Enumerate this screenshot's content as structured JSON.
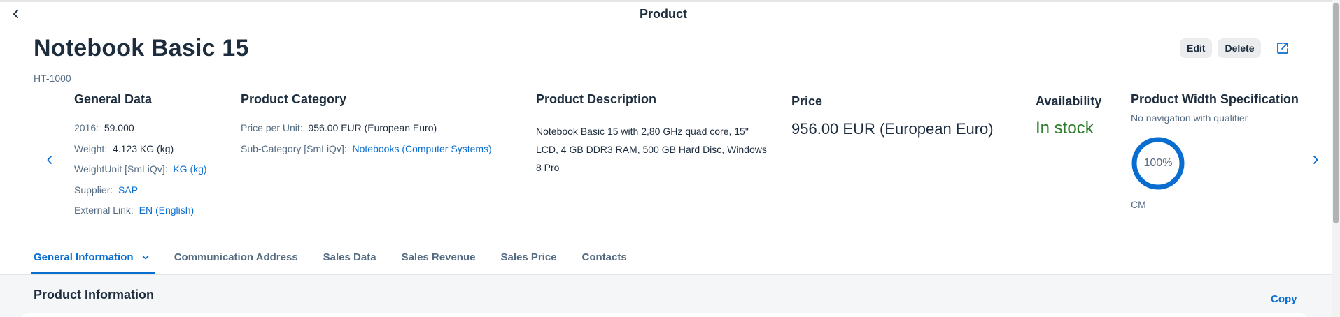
{
  "header": {
    "title": "Product"
  },
  "object": {
    "title": "Notebook Basic 15",
    "subtitle": "HT-1000"
  },
  "actions": {
    "edit": "Edit",
    "delete": "Delete"
  },
  "general_data": {
    "title": "General Data",
    "fields": [
      {
        "label": "2016:",
        "value": "59.000"
      },
      {
        "label": "Weight:",
        "value": "4.123 KG (kg)"
      },
      {
        "label": "WeightUnit [SmLiQv]:",
        "value": "KG (kg)"
      },
      {
        "label": "Supplier:",
        "value": "SAP"
      },
      {
        "label": "External Link:",
        "value": "EN (English)"
      }
    ]
  },
  "product_category": {
    "title": "Product Category",
    "fields": [
      {
        "label": "Price per Unit:",
        "value": "956.00  EUR (European Euro)"
      },
      {
        "label": "Sub-Category [SmLiQv]:",
        "value": "Notebooks (Computer Systems)"
      }
    ]
  },
  "product_description": {
    "title": "Product Description",
    "text": "Notebook Basic 15 with 2,80 GHz quad core, 15\" LCD, 4 GB DDR3 RAM, 500 GB Hard Disc, Windows 8 Pro"
  },
  "price": {
    "title": "Price",
    "value": "956.00  EUR (European Euro)"
  },
  "availability": {
    "title": "Availability",
    "value": "In stock",
    "color": "#2b7d2b"
  },
  "width_spec": {
    "title": "Product Width Specification",
    "subtitle": "No navigation with qualifier",
    "percent_label": "100%",
    "fraction": 1.0,
    "unit": "CM",
    "color": "#0a6ed1"
  },
  "tabs": [
    {
      "label": "General Information"
    },
    {
      "label": "Communication Address"
    },
    {
      "label": "Sales Data"
    },
    {
      "label": "Sales Revenue"
    },
    {
      "label": "Sales Price"
    },
    {
      "label": "Contacts"
    }
  ],
  "section": {
    "title": "Product Information",
    "copy_label": "Copy"
  },
  "colors": {
    "accent": "#0a6ed1",
    "text": "#1d2d3e",
    "muted": "#556b82",
    "success": "#2b7d2b"
  },
  "icons": {
    "back": "chevron-left-icon",
    "share": "share-icon",
    "prev": "chevron-left-icon",
    "next": "chevron-right-icon",
    "tab_menu": "chevron-down-icon"
  }
}
